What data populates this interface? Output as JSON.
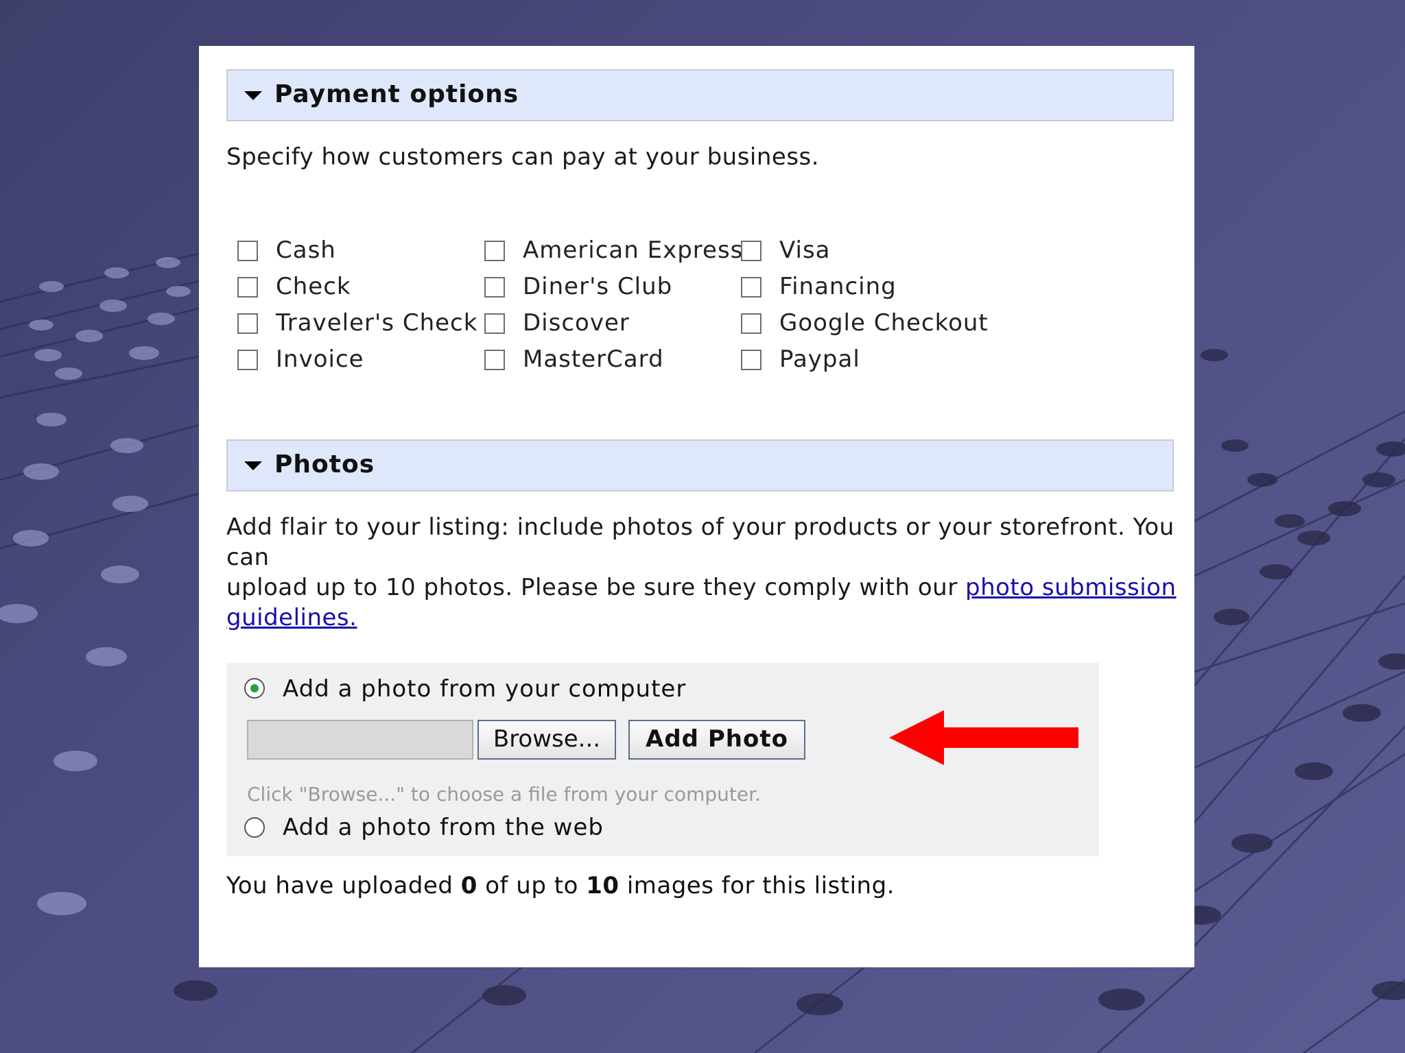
{
  "payment": {
    "header": "Payment options",
    "description": "Specify how customers can pay at your business.",
    "options": [
      [
        "Cash",
        "Check",
        "Traveler's Check",
        "Invoice"
      ],
      [
        "American Express",
        "Diner's Club",
        "Discover",
        "MasterCard"
      ],
      [
        "Visa",
        "Financing",
        "Google Checkout",
        "Paypal"
      ]
    ]
  },
  "photos": {
    "header": "Photos",
    "desc_line1": "Add flair to your listing: include photos of your products or your storefront. You can",
    "desc_line2_text": "upload up to 10 photos. Please be sure they comply with our ",
    "desc_link_1": "photo submission",
    "desc_link_2": "guidelines.",
    "radio_computer": "Add a photo from your computer",
    "radio_web": "Add a photo from the web",
    "browse_label": "Browse...",
    "add_photo_label": "Add Photo",
    "hint": "Click \"Browse...\" to choose a file from your computer.",
    "summary_prefix": "You have uploaded ",
    "uploaded_count": "0",
    "summary_middle": " of up to ",
    "max_count": "10",
    "summary_suffix": " images for this listing."
  },
  "colors": {
    "arrow": "#ff0000",
    "header_bg": "#dfe8fb",
    "link": "#1a0dab"
  }
}
